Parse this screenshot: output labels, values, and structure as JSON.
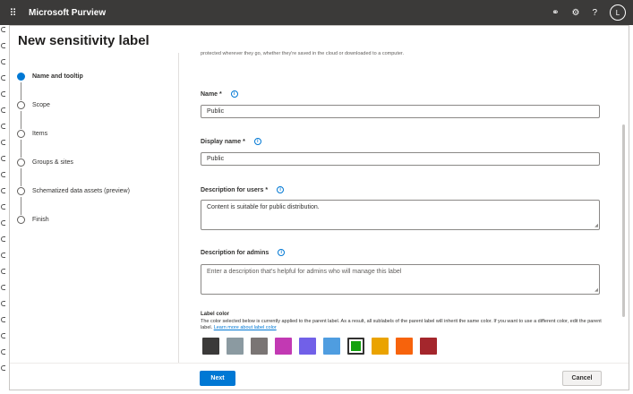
{
  "topbar": {
    "app_title": "Microsoft Purview",
    "icons": [
      "waffle-icon",
      "share-icon",
      "settings-icon",
      "help-icon"
    ],
    "avatar_initial": "L"
  },
  "page": {
    "title": "New sensitivity label"
  },
  "steps": [
    {
      "label": "Name and tooltip",
      "active": true
    },
    {
      "label": "Scope",
      "active": false
    },
    {
      "label": "Items",
      "active": false
    },
    {
      "label": "Groups & sites",
      "active": false
    },
    {
      "label": "Schematized data assets (preview)",
      "active": false
    },
    {
      "label": "Finish",
      "active": false
    }
  ],
  "form": {
    "intro_text": "protected wherever they go, whether they're saved in the cloud or downloaded to a computer.",
    "name_label": "Name *",
    "name_value": "Public",
    "display_name_label": "Display name *",
    "display_name_value": "Public",
    "desc_users_label": "Description for users *",
    "desc_users_value": "Content is suitable for public distribution.",
    "desc_admins_label": "Description for admins",
    "desc_admins_placeholder": "Enter a description that's helpful for admins who will manage this label",
    "label_color_title": "Label color",
    "label_color_note": "The color selected below is currently applied to the parent label. As a result, all sublabels of the parent label will inherit the same color. If you want to use a different color, edit the parent label.",
    "label_color_link": "Learn more about label color",
    "swatches": [
      {
        "color": "#3b3a39",
        "selected": false
      },
      {
        "color": "#8b9aa1",
        "selected": false
      },
      {
        "color": "#7a7574",
        "selected": false
      },
      {
        "color": "#c239b3",
        "selected": false
      },
      {
        "color": "#7160e8",
        "selected": false
      },
      {
        "color": "#4f9de0",
        "selected": false
      },
      {
        "color": "#13a10e",
        "selected": true
      },
      {
        "color": "#eaa300",
        "selected": false
      },
      {
        "color": "#f7630c",
        "selected": false
      },
      {
        "color": "#a4262c",
        "selected": false
      }
    ]
  },
  "footer": {
    "next_label": "Next",
    "cancel_label": "Cancel"
  },
  "colors": {
    "topbar_bg": "#3b3a39",
    "accent": "#0078d4"
  }
}
